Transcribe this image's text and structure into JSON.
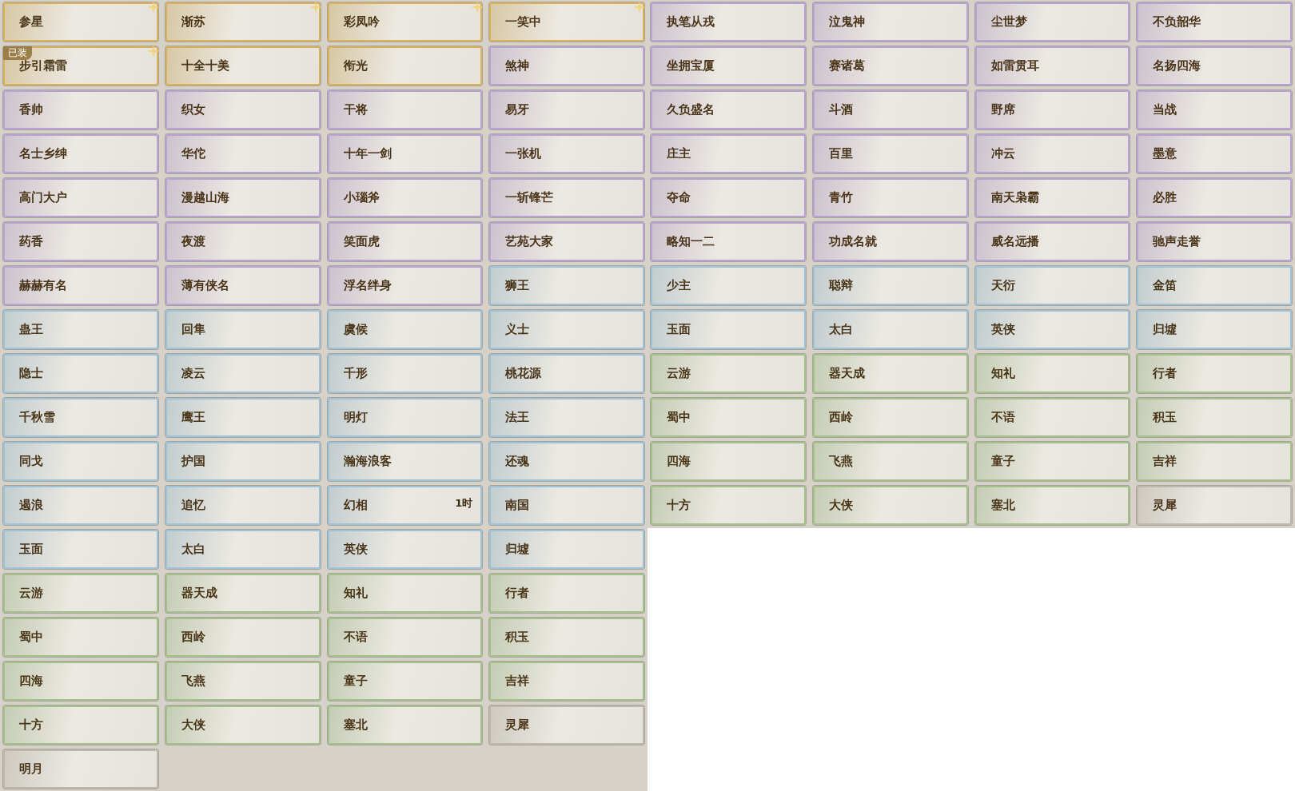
{
  "panels": [
    {
      "tiles": [
        {
          "label": "参星",
          "color": "#d9b25a",
          "starred": true
        },
        {
          "label": "渐苏",
          "color": "#d9b25a",
          "starred": true
        },
        {
          "label": "彩凤吟",
          "color": "#d9b25a",
          "starred": true
        },
        {
          "label": "一笑中",
          "color": "#d9b25a",
          "starred": true
        },
        {
          "label": "步引霜雷",
          "color": "#d9b25a",
          "starred": true,
          "badge": "已装"
        },
        {
          "label": "十全十美",
          "color": "#d9b25a",
          "starred": false
        },
        {
          "label": "衔光",
          "color": "#d9b25a",
          "starred": false
        },
        {
          "label": "煞神",
          "color": "#b9a3d6",
          "starred": false
        },
        {
          "label": "香帅",
          "color": "#b9a3d6",
          "starred": false
        },
        {
          "label": "织女",
          "color": "#b9a3d6",
          "starred": false
        },
        {
          "label": "干将",
          "color": "#b9a3d6",
          "starred": false
        },
        {
          "label": "易牙",
          "color": "#b9a3d6",
          "starred": false
        },
        {
          "label": "名士乡绅",
          "color": "#b9a3d6",
          "starred": false
        },
        {
          "label": "华佗",
          "color": "#b9a3d6",
          "starred": false
        },
        {
          "label": "十年一剑",
          "color": "#b9a3d6",
          "starred": false
        },
        {
          "label": "一张机",
          "color": "#b9a3d6",
          "starred": false
        },
        {
          "label": "高门大户",
          "color": "#b9a3d6",
          "starred": false
        },
        {
          "label": "漫越山海",
          "color": "#b9a3d6",
          "starred": false
        },
        {
          "label": "小瑙斧",
          "color": "#b9a3d6",
          "starred": false
        },
        {
          "label": "一斩锋芒",
          "color": "#b9a3d6",
          "starred": false
        },
        {
          "label": "药香",
          "color": "#b9a3d6",
          "starred": false
        },
        {
          "label": "夜渡",
          "color": "#b9a3d6",
          "starred": false
        },
        {
          "label": "笑面虎",
          "color": "#b9a3d6",
          "starred": false
        },
        {
          "label": "艺苑大家",
          "color": "#b9a3d6",
          "starred": false
        },
        {
          "label": "赫赫有名",
          "color": "#b9a3d6",
          "starred": false
        },
        {
          "label": "薄有侠名",
          "color": "#b9a3d6",
          "starred": false
        },
        {
          "label": "浮名绊身",
          "color": "#b9a3d6",
          "starred": false
        },
        {
          "label": "狮王",
          "color": "#9cc3d9",
          "starred": false
        },
        {
          "label": "蛊王",
          "color": "#9cc3d9",
          "starred": false
        },
        {
          "label": "回隼",
          "color": "#9cc3d9",
          "starred": false
        },
        {
          "label": "虞候",
          "color": "#9cc3d9",
          "starred": false
        },
        {
          "label": "义士",
          "color": "#9cc3d9",
          "starred": false
        },
        {
          "label": "隐士",
          "color": "#9cc3d9",
          "starred": false
        },
        {
          "label": "凌云",
          "color": "#9cc3d9",
          "starred": false
        },
        {
          "label": "千形",
          "color": "#9cc3d9",
          "starred": false
        },
        {
          "label": "桃花源",
          "color": "#9cc3d9",
          "starred": false
        },
        {
          "label": "千秋雪",
          "color": "#9cc3d9",
          "starred": false
        },
        {
          "label": "鹰王",
          "color": "#9cc3d9",
          "starred": false
        },
        {
          "label": "明灯",
          "color": "#9cc3d9",
          "starred": false
        },
        {
          "label": "法王",
          "color": "#9cc3d9",
          "starred": false
        },
        {
          "label": "同戈",
          "color": "#9cc3d9",
          "starred": false
        },
        {
          "label": "护国",
          "color": "#9cc3d9",
          "starred": false
        },
        {
          "label": "瀚海浪客",
          "color": "#9cc3d9",
          "starred": false
        },
        {
          "label": "还魂",
          "color": "#9cc3d9",
          "starred": false
        },
        {
          "label": "遏浪",
          "color": "#9cc3d9",
          "starred": false
        },
        {
          "label": "追忆",
          "color": "#9cc3d9",
          "starred": false
        },
        {
          "label": "幻相",
          "color": "#9cc3d9",
          "starred": false,
          "timer": "1时"
        },
        {
          "label": "南国",
          "color": "#9cc3d9",
          "starred": false
        },
        {
          "label": "玉面",
          "color": "#9cc3d9",
          "starred": false
        },
        {
          "label": "太白",
          "color": "#9cc3d9",
          "starred": false
        },
        {
          "label": "英侠",
          "color": "#9cc3d9",
          "starred": false
        },
        {
          "label": "归墟",
          "color": "#9cc3d9",
          "starred": false
        },
        {
          "label": "云游",
          "color": "#a3c28a",
          "starred": false
        },
        {
          "label": "器天成",
          "color": "#a3c28a",
          "starred": false
        },
        {
          "label": "知礼",
          "color": "#a3c28a",
          "starred": false
        },
        {
          "label": "行者",
          "color": "#a3c28a",
          "starred": false
        },
        {
          "label": "蜀中",
          "color": "#a3c28a",
          "starred": false
        },
        {
          "label": "西岭",
          "color": "#a3c28a",
          "starred": false
        },
        {
          "label": "不语",
          "color": "#a3c28a",
          "starred": false
        },
        {
          "label": "积玉",
          "color": "#a3c28a",
          "starred": false
        },
        {
          "label": "四海",
          "color": "#a3c28a",
          "starred": false
        },
        {
          "label": "飞燕",
          "color": "#a3c28a",
          "starred": false
        },
        {
          "label": "童子",
          "color": "#a3c28a",
          "starred": false
        },
        {
          "label": "吉祥",
          "color": "#a3c28a",
          "starred": false
        },
        {
          "label": "十方",
          "color": "#a3c28a",
          "starred": false
        },
        {
          "label": "大侠",
          "color": "#a3c28a",
          "starred": false
        },
        {
          "label": "塞北",
          "color": "#a3c28a",
          "starred": false
        },
        {
          "label": "灵犀",
          "color": "#bdb9b1",
          "starred": false
        },
        {
          "label": "明月",
          "color": "#bdb9b1",
          "starred": false
        }
      ]
    },
    {
      "tiles": [
        {
          "label": "执笔从戎",
          "color": "#b9a3d6",
          "starred": false
        },
        {
          "label": "泣鬼神",
          "color": "#b9a3d6",
          "starred": false
        },
        {
          "label": "尘世梦",
          "color": "#b9a3d6",
          "starred": false
        },
        {
          "label": "不负韶华",
          "color": "#b9a3d6",
          "starred": false
        },
        {
          "label": "坐拥宝厦",
          "color": "#b9a3d6",
          "starred": false
        },
        {
          "label": "赛诸葛",
          "color": "#b9a3d6",
          "starred": false
        },
        {
          "label": "如雷贯耳",
          "color": "#b9a3d6",
          "starred": false
        },
        {
          "label": "名扬四海",
          "color": "#b9a3d6",
          "starred": false
        },
        {
          "label": "久负盛名",
          "color": "#b9a3d6",
          "starred": false
        },
        {
          "label": "斗酒",
          "color": "#b9a3d6",
          "starred": false
        },
        {
          "label": "野席",
          "color": "#b9a3d6",
          "starred": false
        },
        {
          "label": "当战",
          "color": "#b9a3d6",
          "starred": false
        },
        {
          "label": "庄主",
          "color": "#b9a3d6",
          "starred": false
        },
        {
          "label": "百里",
          "color": "#b9a3d6",
          "starred": false
        },
        {
          "label": "冲云",
          "color": "#b9a3d6",
          "starred": false
        },
        {
          "label": "墨意",
          "color": "#b9a3d6",
          "starred": false
        },
        {
          "label": "夺命",
          "color": "#b9a3d6",
          "starred": false
        },
        {
          "label": "青竹",
          "color": "#b9a3d6",
          "starred": false
        },
        {
          "label": "南天枭霸",
          "color": "#b9a3d6",
          "starred": false
        },
        {
          "label": "必胜",
          "color": "#b9a3d6",
          "starred": false
        },
        {
          "label": "略知一二",
          "color": "#b9a3d6",
          "starred": false
        },
        {
          "label": "功成名就",
          "color": "#b9a3d6",
          "starred": false
        },
        {
          "label": "威名远播",
          "color": "#b9a3d6",
          "starred": false
        },
        {
          "label": "驰声走誉",
          "color": "#b9a3d6",
          "starred": false
        },
        {
          "label": "少主",
          "color": "#9cc3d9",
          "starred": false
        },
        {
          "label": "聪辩",
          "color": "#9cc3d9",
          "starred": false
        },
        {
          "label": "天衍",
          "color": "#9cc3d9",
          "starred": false
        },
        {
          "label": "金笛",
          "color": "#9cc3d9",
          "starred": false
        },
        {
          "label": "玉面",
          "color": "#9cc3d9",
          "starred": false
        },
        {
          "label": "太白",
          "color": "#9cc3d9",
          "starred": false
        },
        {
          "label": "英侠",
          "color": "#9cc3d9",
          "starred": false
        },
        {
          "label": "归墟",
          "color": "#9cc3d9",
          "starred": false
        },
        {
          "label": "云游",
          "color": "#a3c28a",
          "starred": false
        },
        {
          "label": "器天成",
          "color": "#a3c28a",
          "starred": false
        },
        {
          "label": "知礼",
          "color": "#a3c28a",
          "starred": false
        },
        {
          "label": "行者",
          "color": "#a3c28a",
          "starred": false
        },
        {
          "label": "蜀中",
          "color": "#a3c28a",
          "starred": false
        },
        {
          "label": "西岭",
          "color": "#a3c28a",
          "starred": false
        },
        {
          "label": "不语",
          "color": "#a3c28a",
          "starred": false
        },
        {
          "label": "积玉",
          "color": "#a3c28a",
          "starred": false
        },
        {
          "label": "四海",
          "color": "#a3c28a",
          "starred": false
        },
        {
          "label": "飞燕",
          "color": "#a3c28a",
          "starred": false
        },
        {
          "label": "童子",
          "color": "#a3c28a",
          "starred": false
        },
        {
          "label": "吉祥",
          "color": "#a3c28a",
          "starred": false
        },
        {
          "label": "十方",
          "color": "#a3c28a",
          "starred": false
        },
        {
          "label": "大侠",
          "color": "#a3c28a",
          "starred": false
        },
        {
          "label": "塞北",
          "color": "#a3c28a",
          "starred": false
        },
        {
          "label": "灵犀",
          "color": "#bdb9b1",
          "starred": false
        }
      ]
    }
  ]
}
